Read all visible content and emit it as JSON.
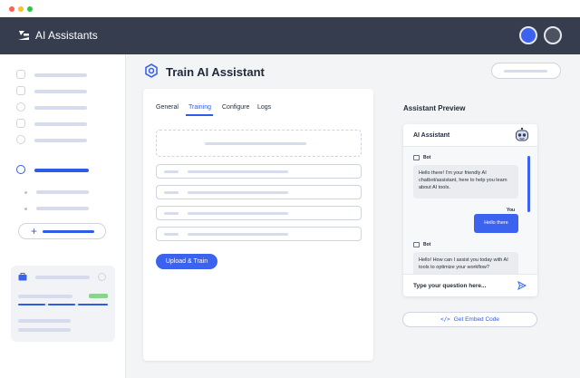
{
  "window": {
    "dots": [
      "#ff5f57",
      "#febc2e",
      "#28c840"
    ]
  },
  "header": {
    "app_title": "AI Assistants",
    "logo_icon": "logo-icon",
    "accent": "#3b63f0",
    "background": "#353d4f"
  },
  "page": {
    "title": "Train AI Assistant",
    "title_icon": "gear-chip-icon"
  },
  "tabs": [
    {
      "label": "General",
      "active": false
    },
    {
      "label": "Training",
      "active": true
    },
    {
      "label": "Configure",
      "active": false
    },
    {
      "label": "Logs",
      "active": false
    }
  ],
  "training": {
    "upload_button": "Upload & Train"
  },
  "sidebar": {
    "add_icon": "plus-icon"
  },
  "preview": {
    "title": "Assistant Preview",
    "chat_title": "AI Assistant",
    "avatar_icon": "robot-icon",
    "messages": [
      {
        "sender": "Bot",
        "text": "Hello there! I'm your friendly AI chatbot/assistant, here to help you learn about AI tools."
      },
      {
        "sender": "You",
        "text": "Hello there"
      },
      {
        "sender": "Bot",
        "text": "Hello! How can I assist you today with AI tools to optimize your workflow?"
      }
    ],
    "input_placeholder": "Type your question here...",
    "send_icon": "send-icon",
    "embed_button": "Get Embed Code",
    "embed_icon": "code-icon"
  }
}
